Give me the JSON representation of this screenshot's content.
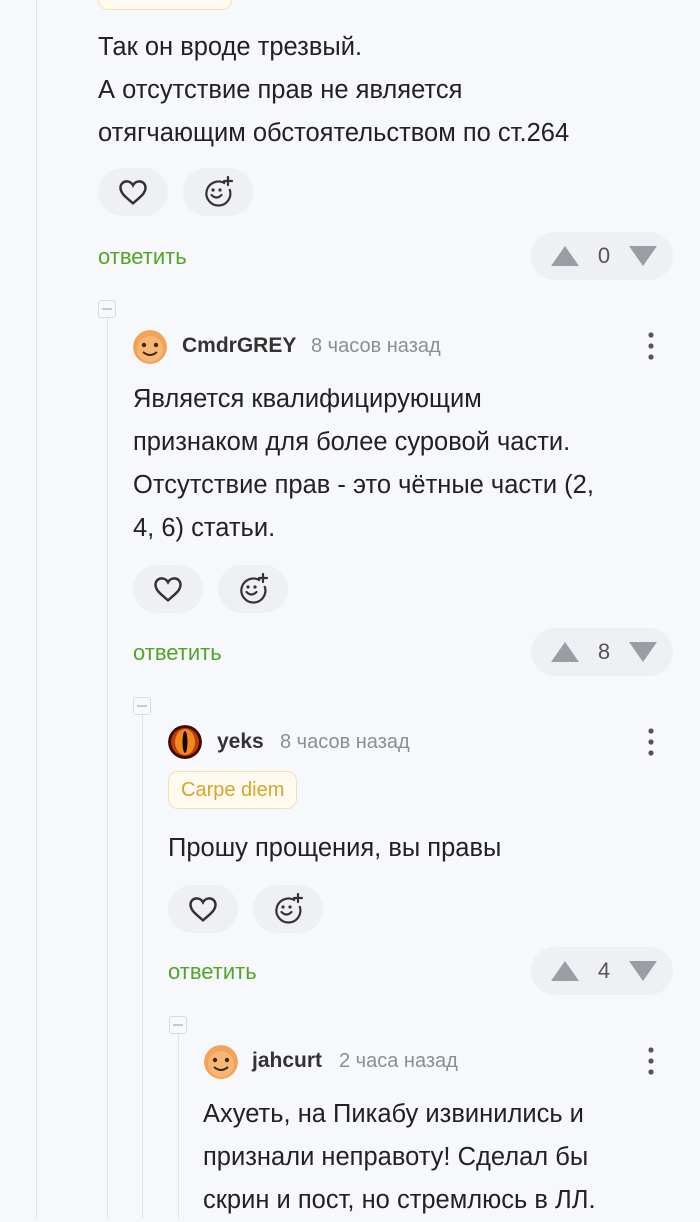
{
  "comment_top": {
    "text": "Так он вроде трезвый.\nА отсутствие прав не является\nотягчающим обстоятельством по ст.264",
    "reply_label": "ответить",
    "rating": "0"
  },
  "comment_cmdrgrey": {
    "author": "CmdrGREY",
    "time": "8 часов назад",
    "text": "Является квалифицирующим\nпризнаком для более суровой части.\nОтсутствие прав - это чётные части (2,\n4, 6) статьи.",
    "reply_label": "ответить",
    "rating": "8"
  },
  "comment_yeks": {
    "author": "yeks",
    "time": "8 часов назад",
    "badge": "Carpe diem",
    "text": "Прошу прощения, вы правы",
    "reply_label": "ответить",
    "rating": "4"
  },
  "comment_jahcurt": {
    "author": "jahcurt",
    "time": "2 часа назад",
    "text": "Ахуеть, на Пикабу извинились и\nпризнали неправоту! Сделал бы\nскрин и пост, но стремлюсь в ЛЛ."
  },
  "icons": {
    "like": "heart-icon",
    "react": "smiley-add-icon",
    "upvote": "triangle-up-icon",
    "downvote": "triangle-down-icon",
    "more": "vertical-dots-icon",
    "collapse": "collapse-minus-icon"
  },
  "colors": {
    "accent_green": "#53a527",
    "badge_text": "#d7a52a",
    "background": "#f7f8fb"
  }
}
